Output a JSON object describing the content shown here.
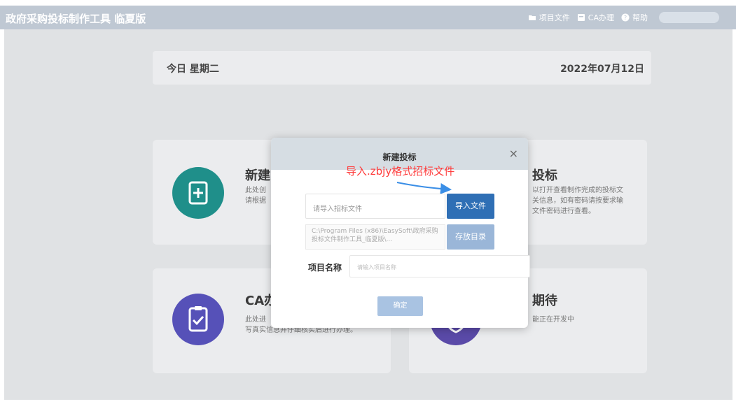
{
  "app": {
    "title": "政府采购投标制作工具 临夏版",
    "top_actions": [
      {
        "label": "项目文件",
        "icon": "folder-icon"
      },
      {
        "label": "CA办理",
        "icon": "card-icon"
      },
      {
        "label": "帮助",
        "icon": "help-icon"
      }
    ]
  },
  "date_card": {
    "left": "今日 星期二",
    "right": "2022年07月12日"
  },
  "features": [
    {
      "title": "新建",
      "desc": "此处创\n请根据",
      "icon": "new-document-icon",
      "color": "#1f8f8a"
    },
    {
      "title": "投标",
      "desc": "以打开查看制作完成的投标文\n关信息，如有密码请按要求输\n文件密码进行查看。",
      "icon": "open-document-icon",
      "color": "#5ea0d8"
    },
    {
      "title": "CA办",
      "desc": "此处进\n写真实信息并仔细核实后进行办理。",
      "icon": "clipboard-check-icon",
      "color": "#5651b8"
    },
    {
      "title": "期待",
      "desc": "能正在开发中",
      "icon": "shield-icon",
      "color": "#5a4aa8"
    }
  ],
  "modal": {
    "title": "新建投标",
    "close": "×",
    "annotation": "导入.zbjy格式招标文件",
    "import_placeholder": "请导入招标文件",
    "import_button": "导入文件",
    "dir_text": "C:\\Program Files (x86)\\EasySoft\\政府采购投标文件制作工具_临夏版\\...",
    "dir_button": "存放目录",
    "name_label": "项目名称",
    "name_placeholder": "请输入项目名称",
    "confirm_button": "确定"
  },
  "colors": {
    "titlebar": "#bfc8d3",
    "primary_button": "#2f6fb5",
    "annotation": "#ff3b3b"
  }
}
